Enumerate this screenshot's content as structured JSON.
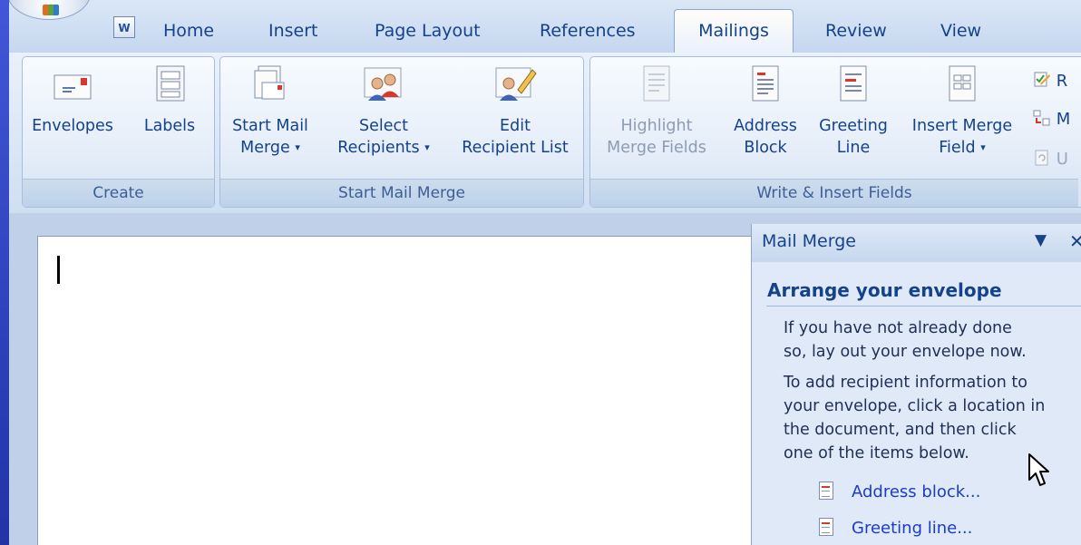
{
  "quick_access": {
    "icon": "word-doc-icon",
    "label": "W"
  },
  "tabs": [
    {
      "label": "Home"
    },
    {
      "label": "Insert"
    },
    {
      "label": "Page Layout"
    },
    {
      "label": "References"
    },
    {
      "label": "Mailings",
      "active": true
    },
    {
      "label": "Review"
    },
    {
      "label": "View"
    }
  ],
  "ribbon": {
    "groups": {
      "create": {
        "label": "Create",
        "buttons": [
          {
            "line1": "Envelopes",
            "line2": ""
          },
          {
            "line1": "Labels",
            "line2": ""
          }
        ]
      },
      "start_mail_merge": {
        "label": "Start Mail Merge",
        "buttons": [
          {
            "line1": "Start Mail",
            "line2": "Merge",
            "caret": "▾"
          },
          {
            "line1": "Select",
            "line2": "Recipients",
            "caret": "▾"
          },
          {
            "line1": "Edit",
            "line2": "Recipient List"
          }
        ]
      },
      "write_insert": {
        "label": "Write & Insert Fields",
        "buttons": [
          {
            "line1": "Highlight",
            "line2": "Merge Fields",
            "disabled": true
          },
          {
            "line1": "Address",
            "line2": "Block"
          },
          {
            "line1": "Greeting",
            "line2": "Line"
          },
          {
            "line1": "Insert Merge",
            "line2": "Field",
            "caret": "▾"
          }
        ],
        "small_buttons": [
          {
            "label": "R"
          },
          {
            "label": "M"
          },
          {
            "label": "U",
            "disabled": true
          }
        ]
      }
    }
  },
  "task_pane": {
    "title": "Mail Merge",
    "menu_glyph": "▼",
    "close_glyph": "✕",
    "section_heading": "Arrange your envelope",
    "para1_line1": "If you have not already done",
    "para1_line2": "so, lay out your envelope now.",
    "para2_line1": "To add recipient information to",
    "para2_line2": "your envelope, click a location in",
    "para2_line3": "the document, and then click",
    "para2_line4": "one of the items below.",
    "links": [
      {
        "label": "Address block..."
      },
      {
        "label": "Greeting line..."
      }
    ]
  },
  "colors": {
    "accent": "#15428b",
    "link": "#1c3cc8",
    "ribbon_bg": "#dbe7f7",
    "frame_blue": "#2b3fb4"
  }
}
